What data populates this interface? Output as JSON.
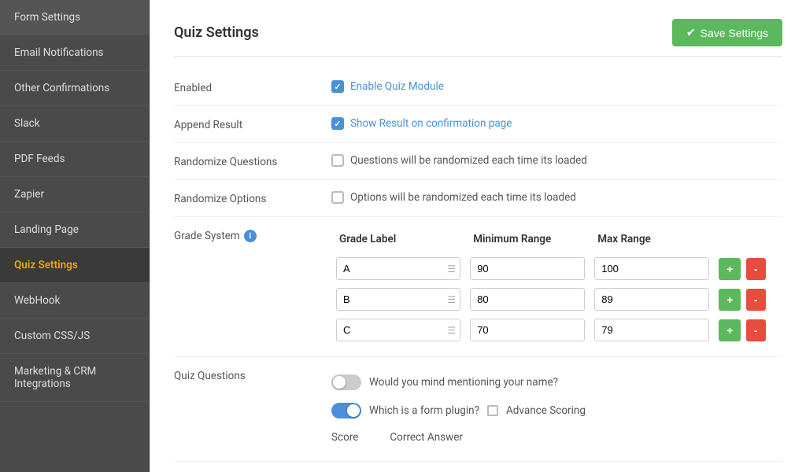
{
  "sidebar": {
    "items": [
      {
        "id": "form-settings",
        "label": "Form Settings",
        "active": false
      },
      {
        "id": "email-notifications",
        "label": "Email Notifications",
        "active": false
      },
      {
        "id": "other-confirmations",
        "label": "Other Confirmations",
        "active": false
      },
      {
        "id": "slack",
        "label": "Slack",
        "active": false
      },
      {
        "id": "pdf-feeds",
        "label": "PDF Feeds",
        "active": false
      },
      {
        "id": "zapier",
        "label": "Zapier",
        "active": false
      },
      {
        "id": "landing-page",
        "label": "Landing Page",
        "active": false
      },
      {
        "id": "quiz-settings",
        "label": "Quiz Settings",
        "active": true
      },
      {
        "id": "webhook",
        "label": "WebHook",
        "active": false
      },
      {
        "id": "custom-css-js",
        "label": "Custom CSS/JS",
        "active": false
      },
      {
        "id": "marketing-crm",
        "label": "Marketing & CRM Integrations",
        "active": false
      }
    ]
  },
  "page": {
    "title": "Quiz Settings",
    "save_button": "Save Settings"
  },
  "form": {
    "enabled_label": "Enabled",
    "enable_quiz_module": "Enable Quiz Module",
    "append_result_label": "Append Result",
    "show_result_label": "Show Result on confirmation page",
    "randomize_questions_label": "Randomize Questions",
    "randomize_questions_text": "Questions will be randomized each time its loaded",
    "randomize_options_label": "Randomize Options",
    "randomize_options_text": "Options will be randomized each time its loaded",
    "grade_system_label": "Grade System",
    "grade_label_col": "Grade Label",
    "min_range_col": "Minimum Range",
    "max_range_col": "Max Range",
    "grades": [
      {
        "label": "A",
        "min": "90",
        "max": "100"
      },
      {
        "label": "B",
        "min": "80",
        "max": "89"
      },
      {
        "label": "C",
        "min": "70",
        "max": "79"
      }
    ],
    "quiz_questions_label": "Quiz Questions",
    "questions": [
      {
        "text": "Would you mind mentioning your name?",
        "enabled": false,
        "advance_scoring": false
      },
      {
        "text": "Which is a form plugin?",
        "enabled": true,
        "advance_scoring": true
      }
    ],
    "advance_scoring_label": "Advance Scoring",
    "score_label": "Score",
    "correct_answer_label": "Correct Answer"
  }
}
